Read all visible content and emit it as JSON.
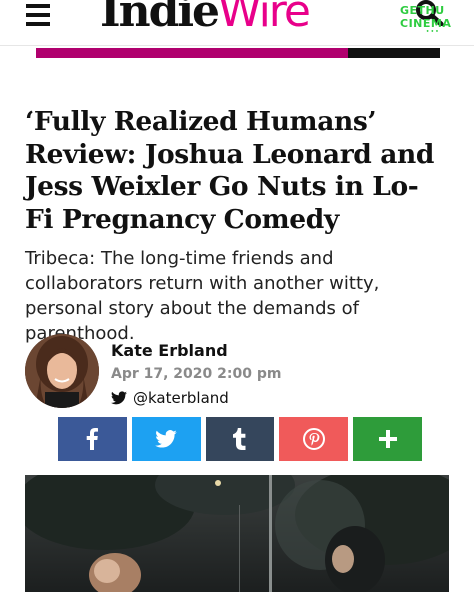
{
  "header": {
    "logo_part1": "Indie",
    "logo_part2": "Wire",
    "logo_color": "#e8008a"
  },
  "watermark": {
    "text": "GETHU CINEMA",
    "sub": "•••"
  },
  "article": {
    "title": "‘Fully Realized Humans’ Review: Joshua Leonard and Jess Weixler Go Nuts in Lo-Fi Pregnancy Comedy",
    "subtitle": "Tribeca: The long-time friends and collaborators return with another witty, personal story about the demands of parenthood."
  },
  "author": {
    "name": "Kate Erbland",
    "date": "Apr 17, 2020 2:00 pm",
    "twitter_handle": "@katerbland",
    "twitter_icon": "twitter-bird-icon"
  },
  "share": {
    "buttons": [
      {
        "icon": "facebook-icon",
        "color": "#3b5998"
      },
      {
        "icon": "twitter-icon",
        "color": "#1da1f2"
      },
      {
        "icon": "tumblr-icon",
        "color": "#35465c"
      },
      {
        "icon": "pinterest-icon",
        "color": "#f05a5a"
      },
      {
        "icon": "plus-icon",
        "color": "#2e9c3a"
      }
    ]
  }
}
